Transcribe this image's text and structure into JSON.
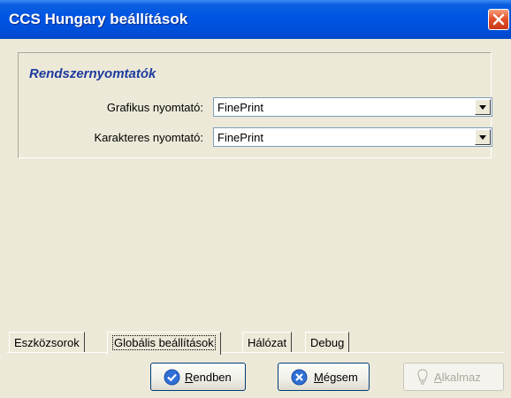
{
  "window": {
    "title": "CCS Hungary beállítások"
  },
  "section": {
    "title": "Rendszernyomtatók",
    "fields": [
      {
        "label": "Grafikus nyomtató:",
        "value": "FinePrint"
      },
      {
        "label": "Karakteres nyomtató:",
        "value": "FinePrint"
      }
    ]
  },
  "tabs": [
    {
      "label": "Eszközsorok",
      "active": false
    },
    {
      "label": "Globális beállítások",
      "active": true
    },
    {
      "label": "Hálózat",
      "active": false
    },
    {
      "label": "Debug",
      "active": false
    }
  ],
  "buttons": {
    "ok": {
      "label_u": "R",
      "label_rest": "endben",
      "icon": "check-icon"
    },
    "cancel": {
      "label_u": "M",
      "label_rest": "égsem",
      "icon": "x-icon"
    },
    "apply": {
      "label_u": "A",
      "label_rest": "lkalmaz",
      "icon": "bulb-icon",
      "disabled": true
    }
  },
  "colors": {
    "titlebar": "#0054e3",
    "section_title": "#1e3b9e",
    "close": "#e5532c"
  }
}
